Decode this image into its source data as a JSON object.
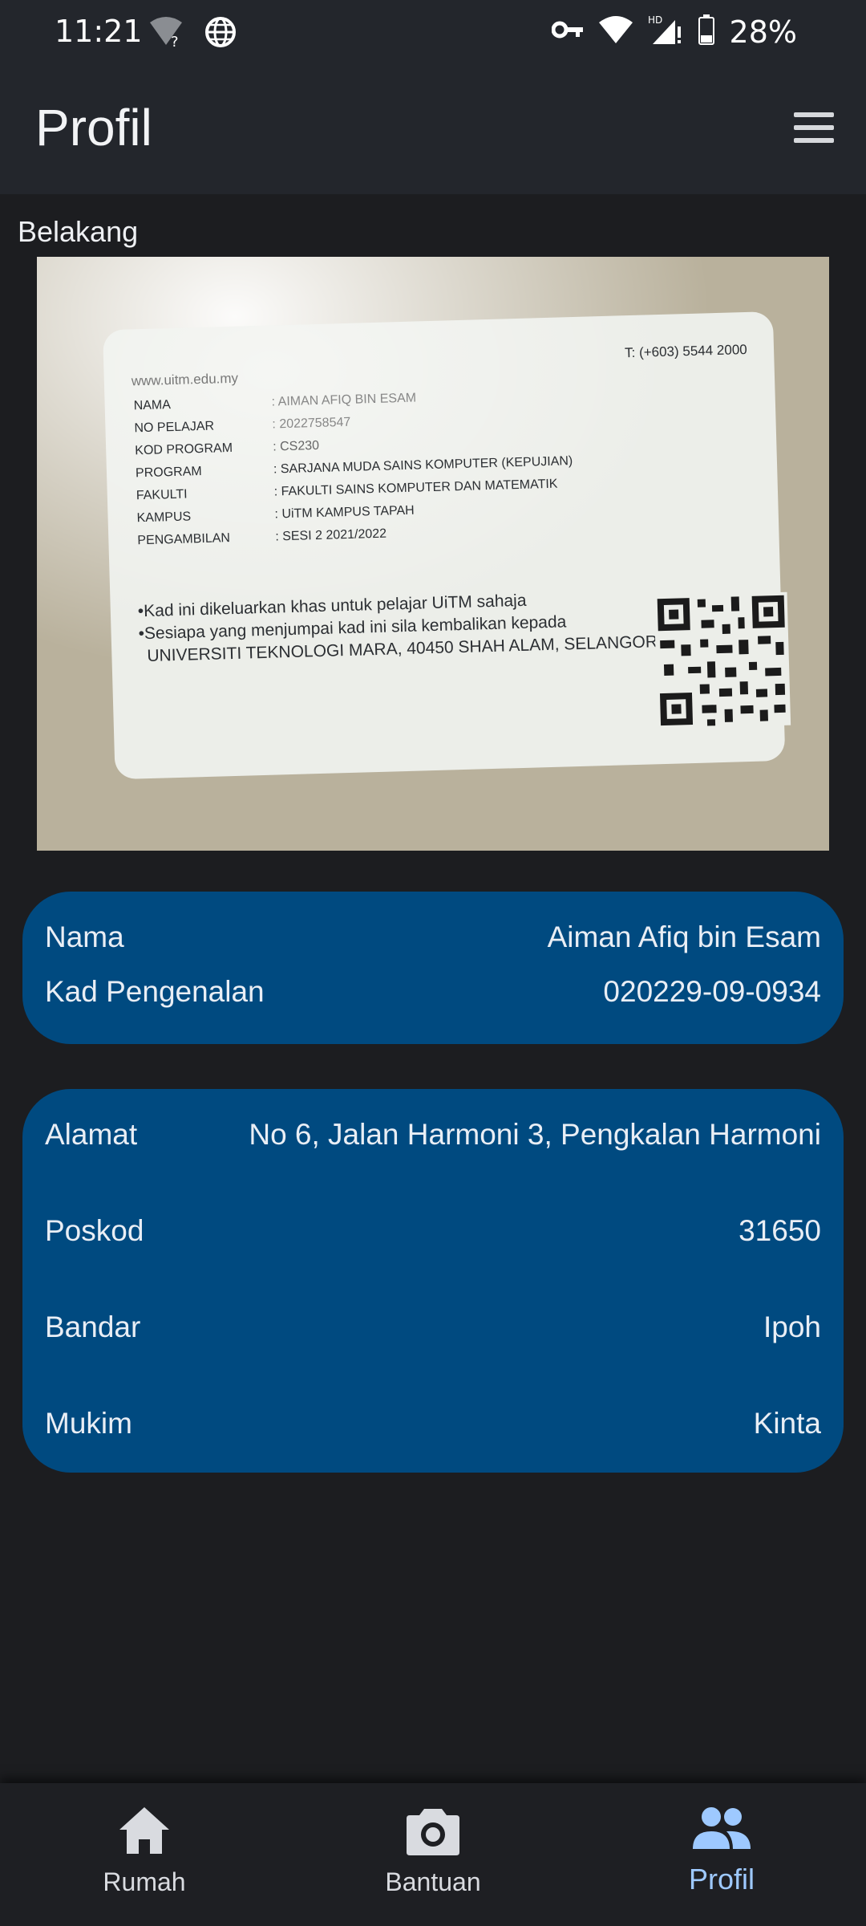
{
  "status_bar": {
    "time": "11:21",
    "battery": "28%",
    "icons": [
      "wifi-unknown-icon",
      "globe-icon",
      "vpn-key-icon",
      "wifi-icon",
      "hd-signal-icon",
      "battery-icon"
    ]
  },
  "app_bar": {
    "title": "Profil",
    "menu_icon": "hamburger-menu-icon"
  },
  "card_section": {
    "label": "Belakang",
    "card_text": {
      "website": "www.uitm.edu.my",
      "phone": "T: (+603) 5544 2000",
      "fields": [
        {
          "label": "NAMA",
          "value": ": AIMAN AFIQ BIN ESAM"
        },
        {
          "label": "NO PELAJAR",
          "value": ": 2022758547"
        },
        {
          "label": "KOD PROGRAM",
          "value": ": CS230"
        },
        {
          "label": "PROGRAM",
          "value": ": SARJANA MUDA SAINS KOMPUTER (KEPUJIAN)"
        },
        {
          "label": "FAKULTI",
          "value": ": FAKULTI SAINS KOMPUTER DAN MATEMATIK"
        },
        {
          "label": "KAMPUS",
          "value": ": UiTM KAMPUS TAPAH"
        },
        {
          "label": "PENGAMBILAN",
          "value": ": SESI 2 2021/2022"
        }
      ],
      "note_1": "•Kad ini dikeluarkan khas untuk pelajar UiTM sahaja",
      "note_2": "•Sesiapa yang menjumpai kad ini sila kembalikan kepada",
      "note_3": "UNIVERSITI TEKNOLOGI MARA, 40450 SHAH ALAM, SELANGOR"
    }
  },
  "identity": {
    "name_label": "Nama",
    "name_value": "Aiman Afiq bin Esam",
    "ic_label": "Kad Pengenalan",
    "ic_value": "020229-09-0934"
  },
  "address": {
    "address_label": "Alamat",
    "address_value": "No 6, Jalan Harmoni 3, Pengkalan Harmoni",
    "postcode_label": "Poskod",
    "postcode_value": "31650",
    "city_label": "Bandar",
    "city_value": "Ipoh",
    "district_label": "Mukim",
    "district_value": "Kinta"
  },
  "bottom_nav": {
    "items": [
      {
        "label": "Rumah",
        "icon": "home-icon"
      },
      {
        "label": "Bantuan",
        "icon": "camera-icon"
      },
      {
        "label": "Profil",
        "icon": "people-icon",
        "active": true
      }
    ],
    "active_color": "#9ec9ff"
  },
  "colors": {
    "panel": "#004a80",
    "background": "#1c1d20",
    "bar": "#23262c"
  }
}
